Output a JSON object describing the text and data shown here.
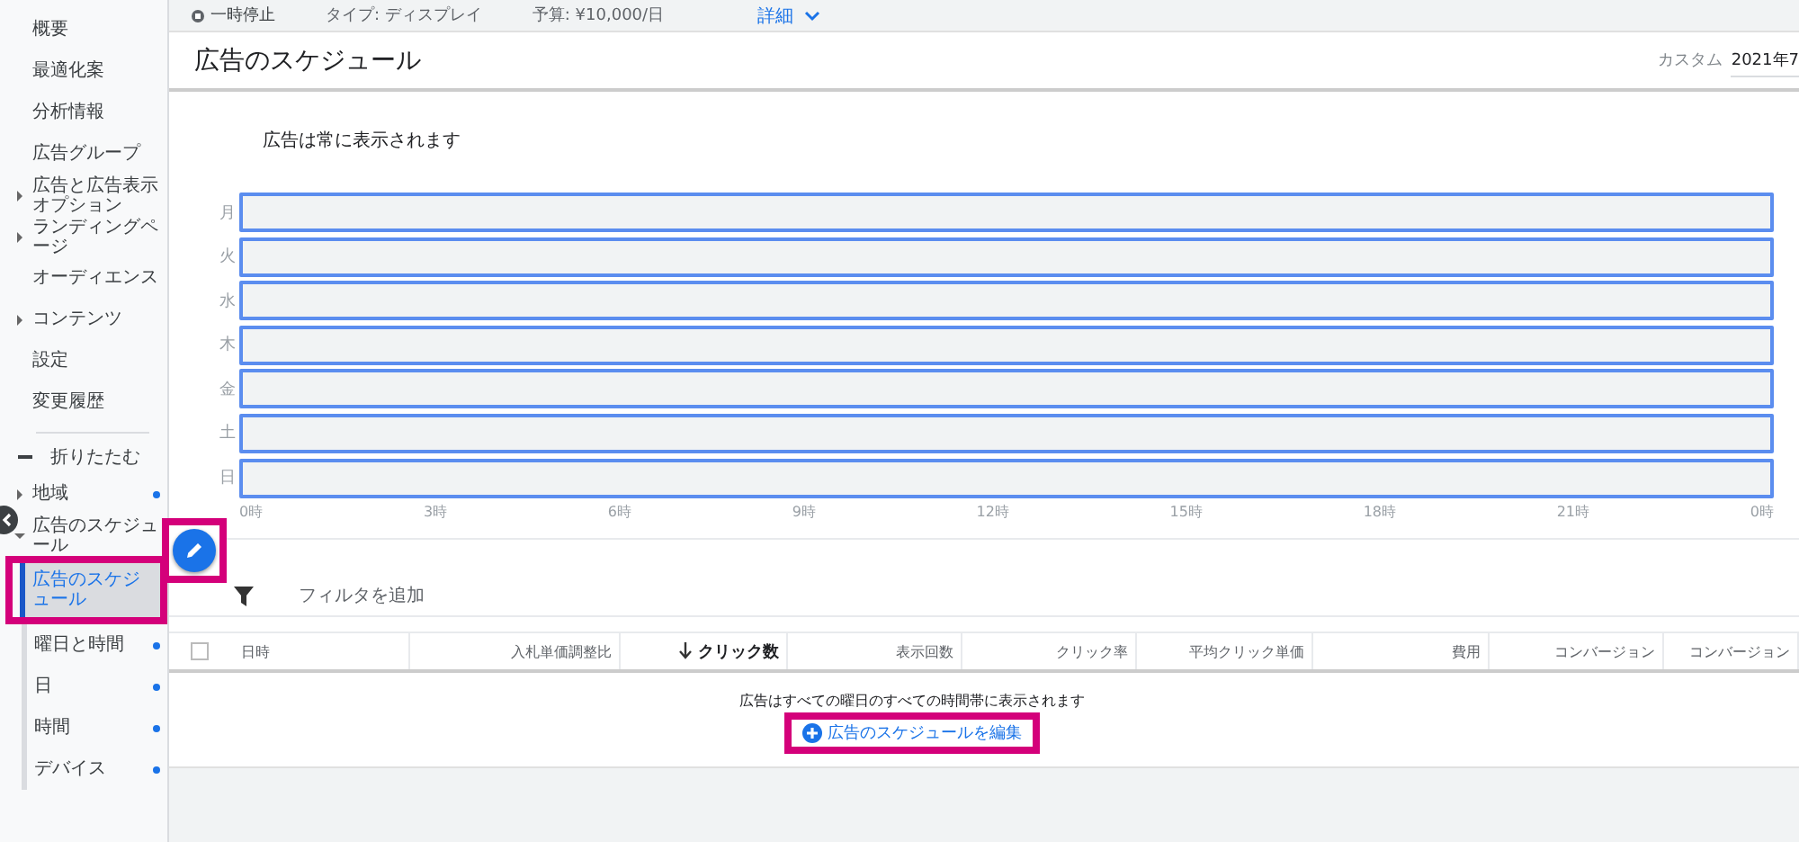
{
  "sidebar": {
    "items": [
      {
        "label": "概要",
        "selected": false
      },
      {
        "label": "最適化案",
        "selected": false
      },
      {
        "label": "分析情報",
        "selected": false
      },
      {
        "label": "広告グループ",
        "selected": false
      },
      {
        "label": "広告と広告表示オプション",
        "selected": false,
        "expanded": false
      },
      {
        "label": "ランディングページ",
        "selected": false,
        "expanded": false
      },
      {
        "label": "オーディエンス",
        "selected": false
      },
      {
        "label": "コンテンツ",
        "selected": false,
        "expanded": false
      },
      {
        "label": "設定",
        "selected": false
      },
      {
        "label": "変更履歴",
        "selected": false
      }
    ],
    "collapse": {
      "label": "折りたたむ"
    },
    "sub_items": [
      {
        "label": "地域",
        "selected": false,
        "expanded": false,
        "dot": true
      },
      {
        "label": "広告のスケジュール",
        "selected": false,
        "expanded": true,
        "dot": false,
        "children": [
          {
            "label": "広告のスケジュール",
            "selected": true,
            "dot": false,
            "highlighted": true
          },
          {
            "label": "曜日と時間",
            "selected": false,
            "dot": true,
            "highlighted": false
          },
          {
            "label": "日",
            "selected": false,
            "dot": true,
            "highlighted": false
          },
          {
            "label": "時間",
            "selected": false,
            "dot": true,
            "highlighted": false
          },
          {
            "label": "デバイス",
            "selected": false,
            "dot": true,
            "highlighted": false
          }
        ]
      }
    ]
  },
  "status_bar": {
    "status": "一時停止",
    "type": "タイプ: ディスプレイ",
    "budget": "予算: ¥10,000/日",
    "details": "詳細"
  },
  "page": {
    "title": "広告のスケジュール",
    "date_label": "カスタム",
    "date_value": "2021年7"
  },
  "schedule": {
    "message": "広告は常に表示されます",
    "days": [
      "月",
      "火",
      "水",
      "木",
      "金",
      "土",
      "日"
    ],
    "hours": [
      "0時",
      "3時",
      "6時",
      "9時",
      "12時",
      "15時",
      "18時",
      "21時",
      "0時"
    ]
  },
  "edit_fab": {
    "highlighted": true
  },
  "filter": {
    "label": "フィルタを追加"
  },
  "table": {
    "columns": [
      {
        "label": "日時",
        "sorted": false
      },
      {
        "label": "入札単価調整比",
        "sorted": false
      },
      {
        "label": "クリック数",
        "sorted": true
      },
      {
        "label": "表示回数",
        "sorted": false
      },
      {
        "label": "クリック率",
        "sorted": false
      },
      {
        "label": "平均クリック単価",
        "sorted": false
      },
      {
        "label": "費用",
        "sorted": false
      },
      {
        "label": "コンバージョン",
        "sorted": false
      },
      {
        "label": "コンバージョン",
        "sorted": false
      }
    ],
    "empty_message": "広告はすべての曜日のすべての時間帯に表示されます",
    "edit_link": {
      "label": "広告のスケジュールを編集",
      "highlighted": true
    }
  }
}
